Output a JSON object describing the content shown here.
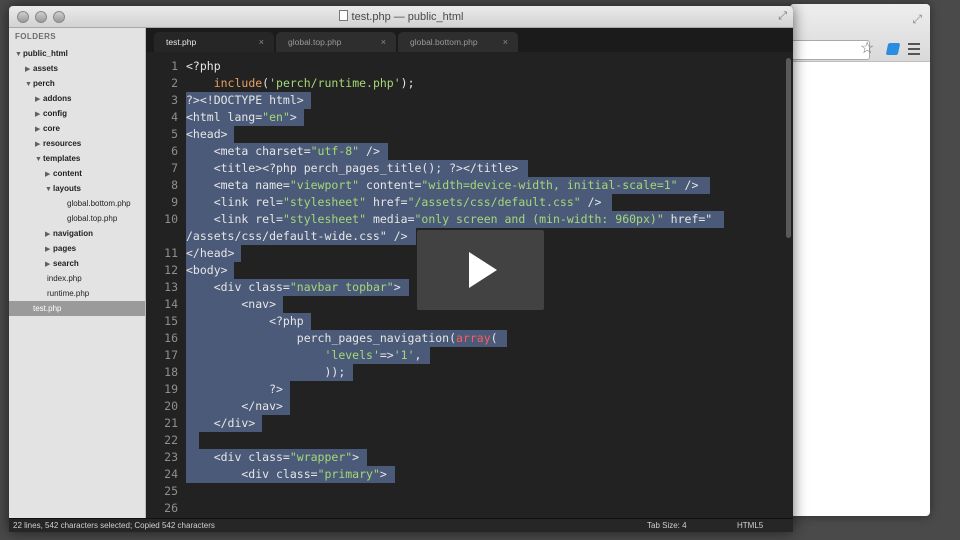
{
  "window": {
    "title": "test.php — public_html"
  },
  "sidebar": {
    "header": "FOLDERS",
    "items": [
      {
        "label": "public_html",
        "indent": 0,
        "arrow": "down",
        "bold": true
      },
      {
        "label": "assets",
        "indent": 1,
        "arrow": "right",
        "bold": true
      },
      {
        "label": "perch",
        "indent": 1,
        "arrow": "down",
        "bold": true
      },
      {
        "label": "addons",
        "indent": 2,
        "arrow": "right",
        "bold": true
      },
      {
        "label": "config",
        "indent": 2,
        "arrow": "right",
        "bold": true
      },
      {
        "label": "core",
        "indent": 2,
        "arrow": "right",
        "bold": true
      },
      {
        "label": "resources",
        "indent": 2,
        "arrow": "right",
        "bold": true
      },
      {
        "label": "templates",
        "indent": 2,
        "arrow": "down",
        "bold": true
      },
      {
        "label": "content",
        "indent": 3,
        "arrow": "right",
        "bold": true
      },
      {
        "label": "layouts",
        "indent": 3,
        "arrow": "down",
        "bold": true
      },
      {
        "label": "global.bottom.php",
        "indent": 4,
        "arrow": "",
        "bold": false
      },
      {
        "label": "global.top.php",
        "indent": 4,
        "arrow": "",
        "bold": false
      },
      {
        "label": "navigation",
        "indent": 3,
        "arrow": "right",
        "bold": true
      },
      {
        "label": "pages",
        "indent": 3,
        "arrow": "right",
        "bold": true
      },
      {
        "label": "search",
        "indent": 3,
        "arrow": "right",
        "bold": true
      },
      {
        "label": "index.php",
        "indent": 2,
        "arrow": "",
        "bold": false
      },
      {
        "label": "runtime.php",
        "indent": 2,
        "arrow": "",
        "bold": false
      },
      {
        "label": "test.php",
        "indent": 1,
        "arrow": "",
        "bold": false,
        "selected": true
      }
    ]
  },
  "tabs": [
    {
      "label": "test.php",
      "active": true
    },
    {
      "label": "global.top.php",
      "active": false
    },
    {
      "label": "global.bottom.php",
      "active": false
    }
  ],
  "tab_close": "×",
  "editor": {
    "lines": [
      {
        "n": "1",
        "text": "<?php",
        "sel": false
      },
      {
        "n": "2",
        "text": "    include('perch/runtime.php');",
        "sel": false
      },
      {
        "n": "3",
        "text": "?><!DOCTYPE html>",
        "sel": true
      },
      {
        "n": "4",
        "text": "<html lang=\"en\">",
        "sel": true
      },
      {
        "n": "5",
        "text": "<head>",
        "sel": true
      },
      {
        "n": "6",
        "text": "    <meta charset=\"utf-8\" />",
        "sel": true
      },
      {
        "n": "7",
        "text": "    <title><?php perch_pages_title(); ?></title>",
        "sel": true
      },
      {
        "n": "8",
        "text": "    <meta name=\"viewport\" content=\"width=device-width, initial-scale=1\" />",
        "sel": true
      },
      {
        "n": "9",
        "text": "    <link rel=\"stylesheet\" href=\"/assets/css/default.css\" />",
        "sel": true
      },
      {
        "n": "10",
        "text": "    <link rel=\"stylesheet\" media=\"only screen and (min-width: 960px)\" href=\"",
        "sel": true
      },
      {
        "n": "",
        "text": "/assets/css/default-wide.css\" />",
        "sel": true
      },
      {
        "n": "11",
        "text": "</head>",
        "sel": true
      },
      {
        "n": "12",
        "text": "<body>",
        "sel": true
      },
      {
        "n": "13",
        "text": "    <div class=\"navbar topbar\">",
        "sel": true
      },
      {
        "n": "14",
        "text": "        <nav>",
        "sel": true
      },
      {
        "n": "15",
        "text": "            <?php",
        "sel": true
      },
      {
        "n": "16",
        "text": "                perch_pages_navigation(array(",
        "sel": true
      },
      {
        "n": "17",
        "text": "                    'levels'=>'1',",
        "sel": true
      },
      {
        "n": "18",
        "text": "                    ));",
        "sel": true
      },
      {
        "n": "19",
        "text": "            ?>",
        "sel": true
      },
      {
        "n": "20",
        "text": "        </nav>",
        "sel": true
      },
      {
        "n": "21",
        "text": "    </div>",
        "sel": true
      },
      {
        "n": "22",
        "text": "",
        "sel": true
      },
      {
        "n": "23",
        "text": "    <div class=\"wrapper\">",
        "sel": true
      },
      {
        "n": "24",
        "text": "        <div class=\"primary\">",
        "sel": true
      },
      {
        "n": "25",
        "text": "",
        "sel": false
      },
      {
        "n": "26",
        "text": "",
        "sel": false
      }
    ]
  },
  "status": {
    "left": "22 lines, 542 characters selected; Copied 542 characters",
    "tab_size": "Tab Size: 4",
    "syntax": "HTML5"
  },
  "colors": {
    "selection": "#4a5a78",
    "editor_bg": "#222222",
    "sidebar_bg": "#e3e3e3"
  }
}
